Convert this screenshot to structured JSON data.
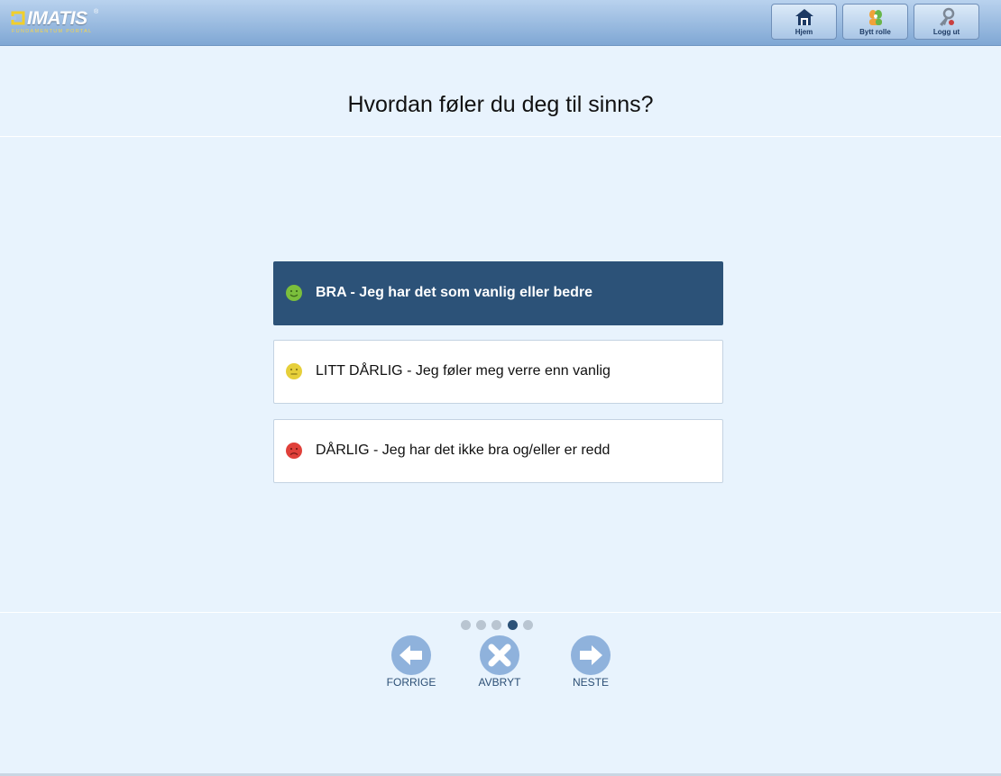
{
  "header": {
    "logo_text": "IMATIS",
    "logo_reg": "®",
    "logo_subtitle": "FUNDAMENTUM PORTAL",
    "buttons": [
      {
        "label": "Hjem",
        "icon": "home-icon"
      },
      {
        "label": "Bytt rolle",
        "icon": "switch-role-icon"
      },
      {
        "label": "Logg ut",
        "icon": "logout-key-icon"
      }
    ]
  },
  "question": "Hvordan føler du deg til sinns?",
  "options": [
    {
      "label": "BRA - Jeg har det som vanlig eller bedre",
      "icon": "happy-face-icon",
      "color": "#7bbf3c",
      "selected": true
    },
    {
      "label": "LITT DÅRLIG - Jeg føler meg verre enn vanlig",
      "icon": "neutral-face-icon",
      "color": "#e6cf3a",
      "selected": false
    },
    {
      "label": "DÅRLIG - Jeg har det ikke bra og/eller er redd",
      "icon": "sad-face-icon",
      "color": "#e0403a",
      "selected": false
    }
  ],
  "pagination": {
    "total": 5,
    "current": 4
  },
  "nav": {
    "previous_label": "FORRIGE",
    "cancel_label": "AVBRYT",
    "next_label": "NESTE"
  },
  "colors": {
    "accent": "#2c5278",
    "background": "#e8f3fd",
    "nav_circle": "#8fb2dc"
  }
}
